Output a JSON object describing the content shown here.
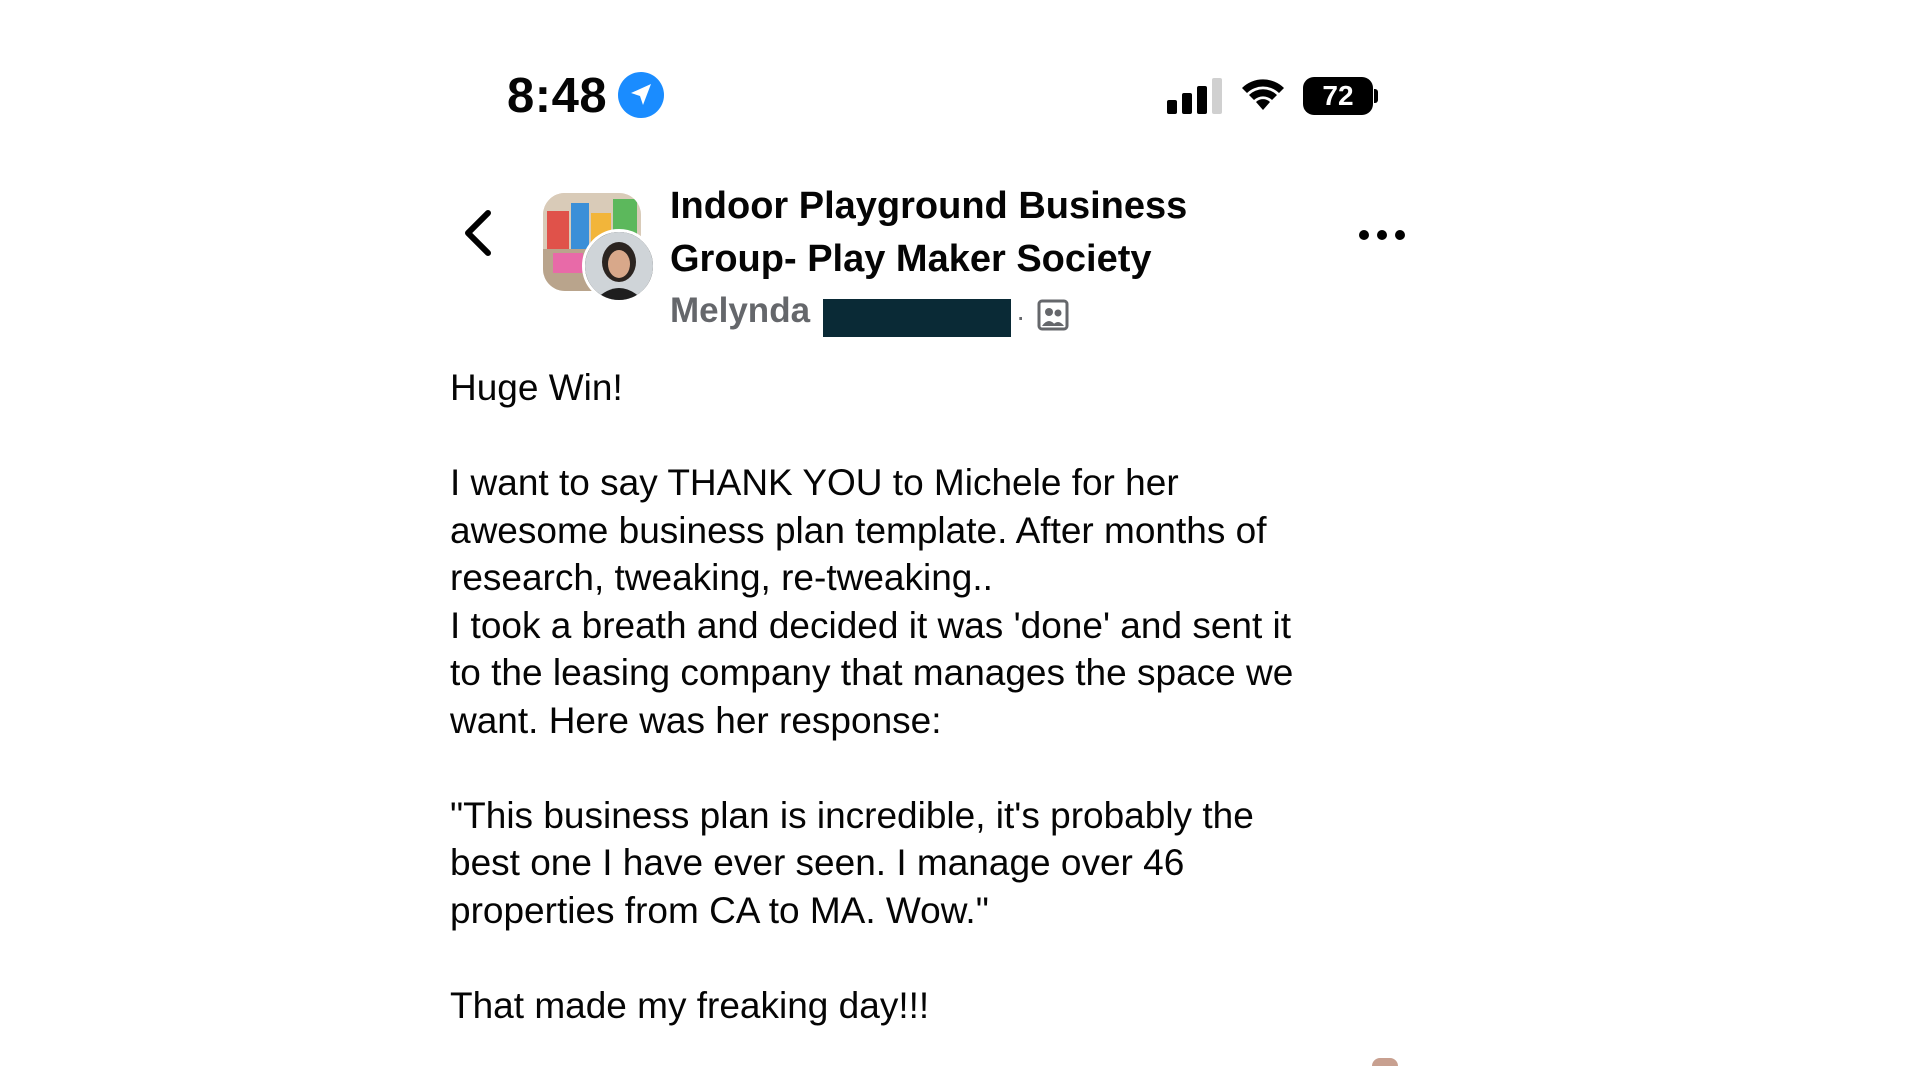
{
  "status_bar": {
    "time": "8:48",
    "battery_level": "72",
    "location_icon": "location-arrow-icon",
    "signal_icon": "cellular-signal-icon",
    "wifi_icon": "wifi-icon",
    "signal_bars_active": 3,
    "signal_bars_total": 4
  },
  "header": {
    "back_icon": "chevron-left-icon",
    "group_name": "Indoor Playground Business Group- Play Maker Society",
    "author_first_name": "Melynda",
    "author_last_name_redacted": true,
    "separator": "·",
    "audience_icon": "group-audience-icon",
    "more_icon": "more-horizontal-icon"
  },
  "post": {
    "paragraphs": [
      "Huge Win!",
      "I want to say THANK YOU to Michele for her\nawesome business plan template.  After months of\nresearch, tweaking, re-tweaking..\nI took a breath and decided it was 'done' and sent it\nto the leasing company that manages the space we\nwant. Here was her response:",
      "\"This business plan is incredible, it's probably the\nbest one I have ever seen. I manage over 46\nproperties from CA to MA. Wow.\"",
      "That made my freaking day!!!"
    ]
  },
  "colors": {
    "text_primary": "#050505",
    "text_secondary": "#65676b",
    "location_blue": "#1a8cff",
    "redaction": "#0a2a36"
  }
}
